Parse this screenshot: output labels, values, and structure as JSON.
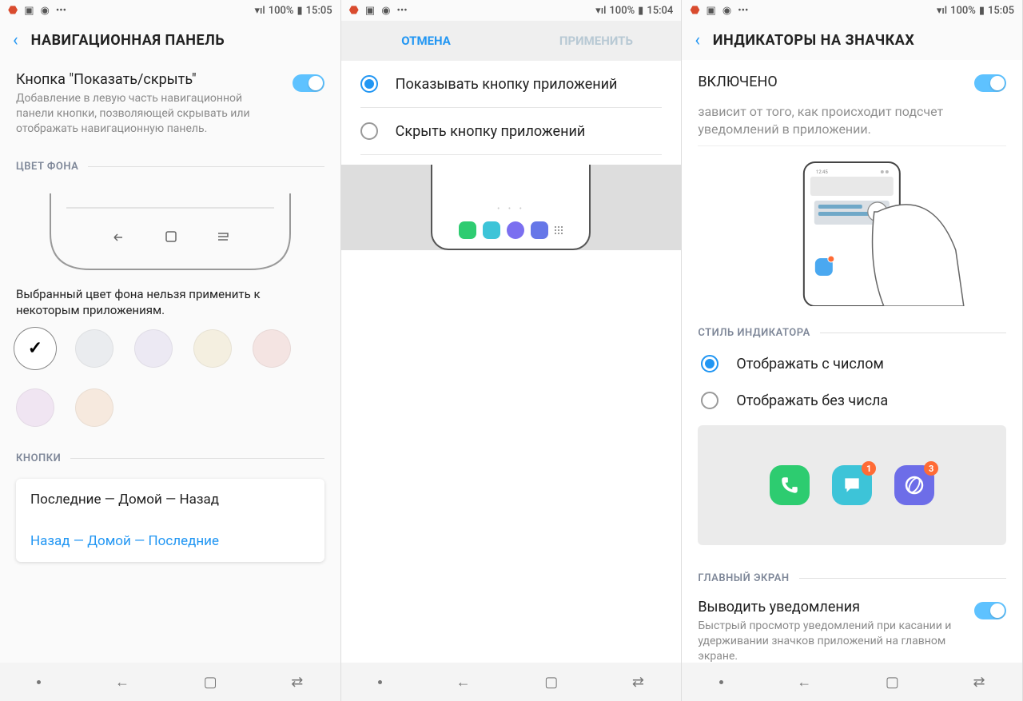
{
  "status": {
    "battery": "100%",
    "time1": "15:05",
    "time2": "15:04",
    "time3": "15:05"
  },
  "phone1": {
    "header": "НАВИГАЦИОННАЯ ПАНЕЛЬ",
    "showhide_title": "Кнопка \"Показать/скрыть\"",
    "showhide_desc": "Добавление в левую часть навигационной панели кнопки, позволяющей скрывать или отображать навигационную панель.",
    "section_bg": "ЦВЕТ ФОНА",
    "color_note": "Выбранный цвет фона нельзя применить к некоторым приложениям.",
    "section_buttons": "КНОПКИ",
    "btn_opt1": "Последние — Домой — Назад",
    "btn_opt2": "Назад — Домой — Последние",
    "colors": [
      "#ffffff",
      "#eaecef",
      "#ece9f3",
      "#f4efe0",
      "#f4e4e2",
      "#f0e5f2",
      "#f6e9de"
    ]
  },
  "phone2": {
    "cancel": "ОТМЕНА",
    "apply": "ПРИМЕНИТЬ",
    "opt1": "Показывать кнопку приложений",
    "opt2": "Скрыть кнопку приложений"
  },
  "phone3": {
    "header": "ИНДИКАТОРЫ НА ЗНАЧКАХ",
    "enabled": "ВКЛЮЧЕНО",
    "desc_cut": "зависит от того, как происходит подсчет уведомлений в приложении.",
    "section_style": "СТИЛЬ ИНДИКАТОРА",
    "style_with": "Отображать с числом",
    "style_without": "Отображать без числа",
    "section_home": "ГЛАВНЫЙ ЭКРАН",
    "notif_title": "Выводить уведомления",
    "notif_desc": "Быстрый просмотр уведомлений при касании и удерживании значков приложений на главном экране.",
    "badge1": "1",
    "badge2": "3"
  }
}
